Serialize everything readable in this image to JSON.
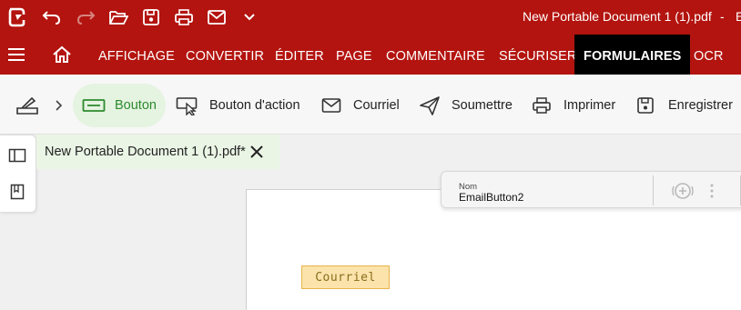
{
  "titlebar": {
    "window_title": "New Portable Document 1 (1).pdf",
    "separator": "-",
    "tail": "E"
  },
  "quick_access": [
    "app-logo-icon",
    "undo-icon",
    "redo-icon",
    "open-folder-icon",
    "save-icon",
    "print-icon",
    "email-icon",
    "chevron-down-icon"
  ],
  "menu": {
    "items": [
      "AFFICHAGE",
      "CONVERTIR",
      "ÉDITER",
      "PAGE",
      "COMMENTAIRE",
      "SÉCURISER",
      "FORMULAIRES",
      "OCR"
    ],
    "active": "FORMULAIRES"
  },
  "toolbar": {
    "bouton": "Bouton",
    "bouton_action": "Bouton d'action",
    "courriel": "Courriel",
    "soumettre": "Soumettre",
    "imprimer": "Imprimer",
    "enregistrer": "Enregistrer"
  },
  "doc_tab": {
    "label": "New Portable Document 1 (1).pdf*"
  },
  "properties": {
    "name_label": "Nom",
    "name_value": "EmailButton2"
  },
  "form_field": {
    "label": "Courriel"
  },
  "colors": {
    "brand_red": "#b3140f",
    "active_tab": "#000000",
    "selected_tool_bg": "#e5f3e1",
    "selected_tool_text": "#2d8a2d",
    "form_button_fill": "#fbe3ab"
  }
}
